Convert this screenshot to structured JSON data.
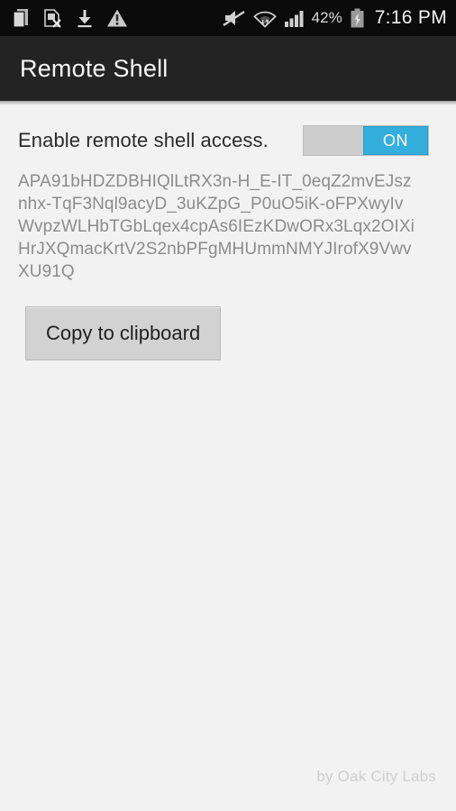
{
  "status_bar": {
    "left_icons": [
      {
        "name": "copy-documents-icon",
        "label": "copy"
      },
      {
        "name": "sim-card-error-icon",
        "label": "sim-error"
      },
      {
        "name": "download-icon",
        "label": "download"
      },
      {
        "name": "warning-triangle-icon",
        "label": "warning"
      }
    ],
    "right_icons": [
      {
        "name": "mute-icon",
        "label": "mute"
      },
      {
        "name": "wifi-icon",
        "label": "wifi"
      },
      {
        "name": "signal-bars-icon",
        "label": "signal"
      }
    ],
    "battery_percent": "42%",
    "battery_icon": "battery-charging-icon",
    "clock": "7:16 PM"
  },
  "action_bar": {
    "title": "Remote Shell"
  },
  "main": {
    "switch": {
      "label": "Enable remote shell access.",
      "state_label": "ON",
      "checked": true
    },
    "token": "APA91bHDZDBHIQlLtRX3n-H_E-IT_0eqZ2mvEJsznhx-TqF3Nql9acyD_3uKZpG_P0uO5iK-oFPXwyIvWvpzWLHbTGbLqex4cpAs6IEzKDwORx3Lqx2OIXiHrJXQmacKrtV2S2nbPFgMHUmmNMYJIrofX9VwvXU91Q",
    "copy_button": "Copy to clipboard"
  },
  "footer": {
    "credit": "by Oak City Labs"
  },
  "colors": {
    "accent_blue": "#33aedd",
    "status_bar_bg": "#0b0b0b",
    "action_bar_bg": "#232323",
    "content_bg": "#f2f2f2",
    "token_text": "#8c8c8c",
    "button_bg": "#d2d2d2"
  }
}
